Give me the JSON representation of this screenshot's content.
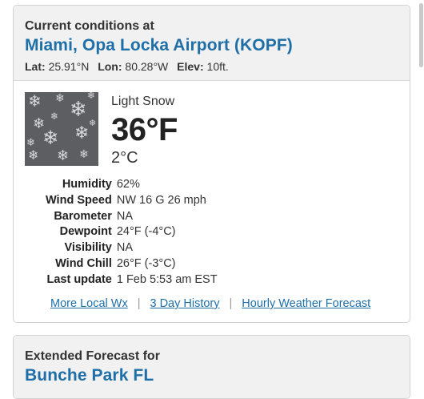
{
  "current": {
    "label": "Current conditions at",
    "location": "Miami, Opa Locka Airport (KOPF)",
    "lat_label": "Lat:",
    "lat_value": "25.91°N",
    "lon_label": "Lon:",
    "lon_value": "80.28°W",
    "elev_label": "Elev:",
    "elev_value": "10ft.",
    "image_icon": "snowflakes-icon",
    "condition": "Light Snow",
    "temp_f": "36°F",
    "temp_c": "2°C",
    "details": [
      {
        "key": "Humidity",
        "value": "62%"
      },
      {
        "key": "Wind Speed",
        "value": "NW 16 G 26 mph"
      },
      {
        "key": "Barometer",
        "value": "NA"
      },
      {
        "key": "Dewpoint",
        "value": "24°F (-4°C)"
      },
      {
        "key": "Visibility",
        "value": "NA"
      },
      {
        "key": "Wind Chill",
        "value": "26°F (-3°C)"
      },
      {
        "key": "Last update",
        "value": "1 Feb 5:53 am EST"
      }
    ],
    "links": {
      "more_local": "More Local Wx",
      "three_day": "3 Day History",
      "hourly": "Hourly Weather Forecast",
      "separator": "|"
    }
  },
  "extended": {
    "label": "Extended Forecast for",
    "location": "Bunche Park FL"
  },
  "colors": {
    "link": "#1e6fa8",
    "header_bg": "#f1f1f1",
    "border": "#d2d2d2"
  }
}
